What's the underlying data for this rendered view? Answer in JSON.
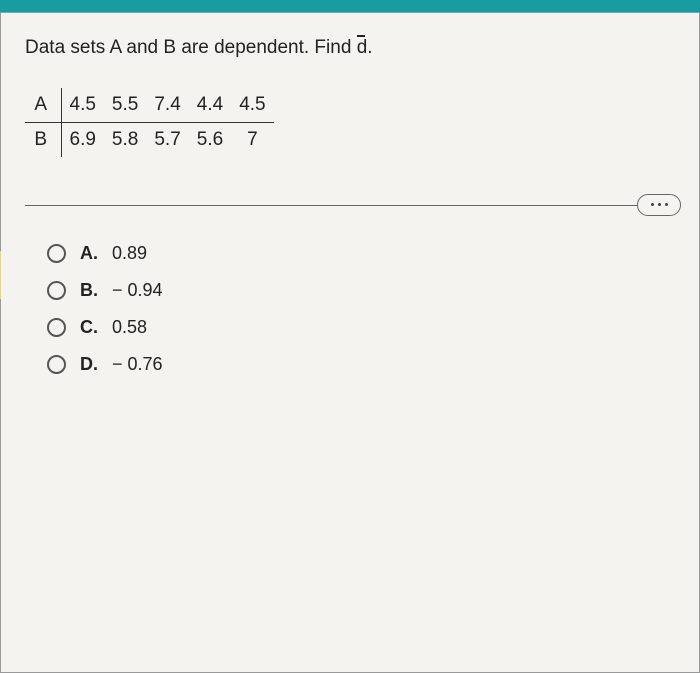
{
  "question": {
    "prefix": "Data sets A and B are dependent. Find ",
    "variable": "d",
    "suffix": "."
  },
  "table": {
    "rows": [
      {
        "label": "A",
        "values": [
          "4.5",
          "5.5",
          "7.4",
          "4.4",
          "4.5"
        ]
      },
      {
        "label": "B",
        "values": [
          "6.9",
          "5.8",
          "5.7",
          "5.6",
          "7"
        ]
      }
    ]
  },
  "options": [
    {
      "letter": "A.",
      "value": "0.89"
    },
    {
      "letter": "B.",
      "value": "− 0.94"
    },
    {
      "letter": "C.",
      "value": "0.58"
    },
    {
      "letter": "D.",
      "value": "− 0.76"
    }
  ]
}
